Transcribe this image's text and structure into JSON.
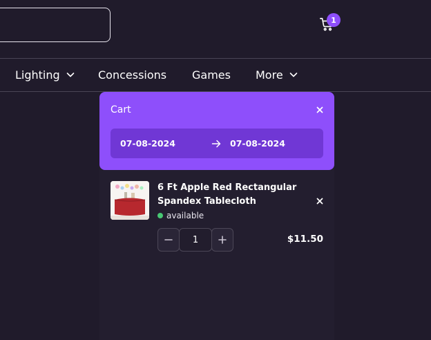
{
  "header": {
    "search": {
      "placeholder": ""
    },
    "cart": {
      "icon": "cart-icon",
      "count": "1"
    }
  },
  "nav": {
    "items": [
      {
        "label": "Lighting",
        "has_dropdown": true
      },
      {
        "label": "Concessions",
        "has_dropdown": false
      },
      {
        "label": "Games",
        "has_dropdown": false
      },
      {
        "label": "More",
        "has_dropdown": true
      }
    ]
  },
  "cart_panel": {
    "title": "Cart",
    "start_date": "07-08-2024",
    "end_date": "07-08-2024",
    "items": [
      {
        "name": "6 Ft Apple Red Rectangular Spandex Tablecloth",
        "status": "available",
        "quantity": "1",
        "price": "$11.50"
      }
    ]
  },
  "colors": {
    "background": "#201b2b",
    "accent": "#8e4ffb",
    "date_bar": "#7037d5",
    "available": "#48c773"
  }
}
